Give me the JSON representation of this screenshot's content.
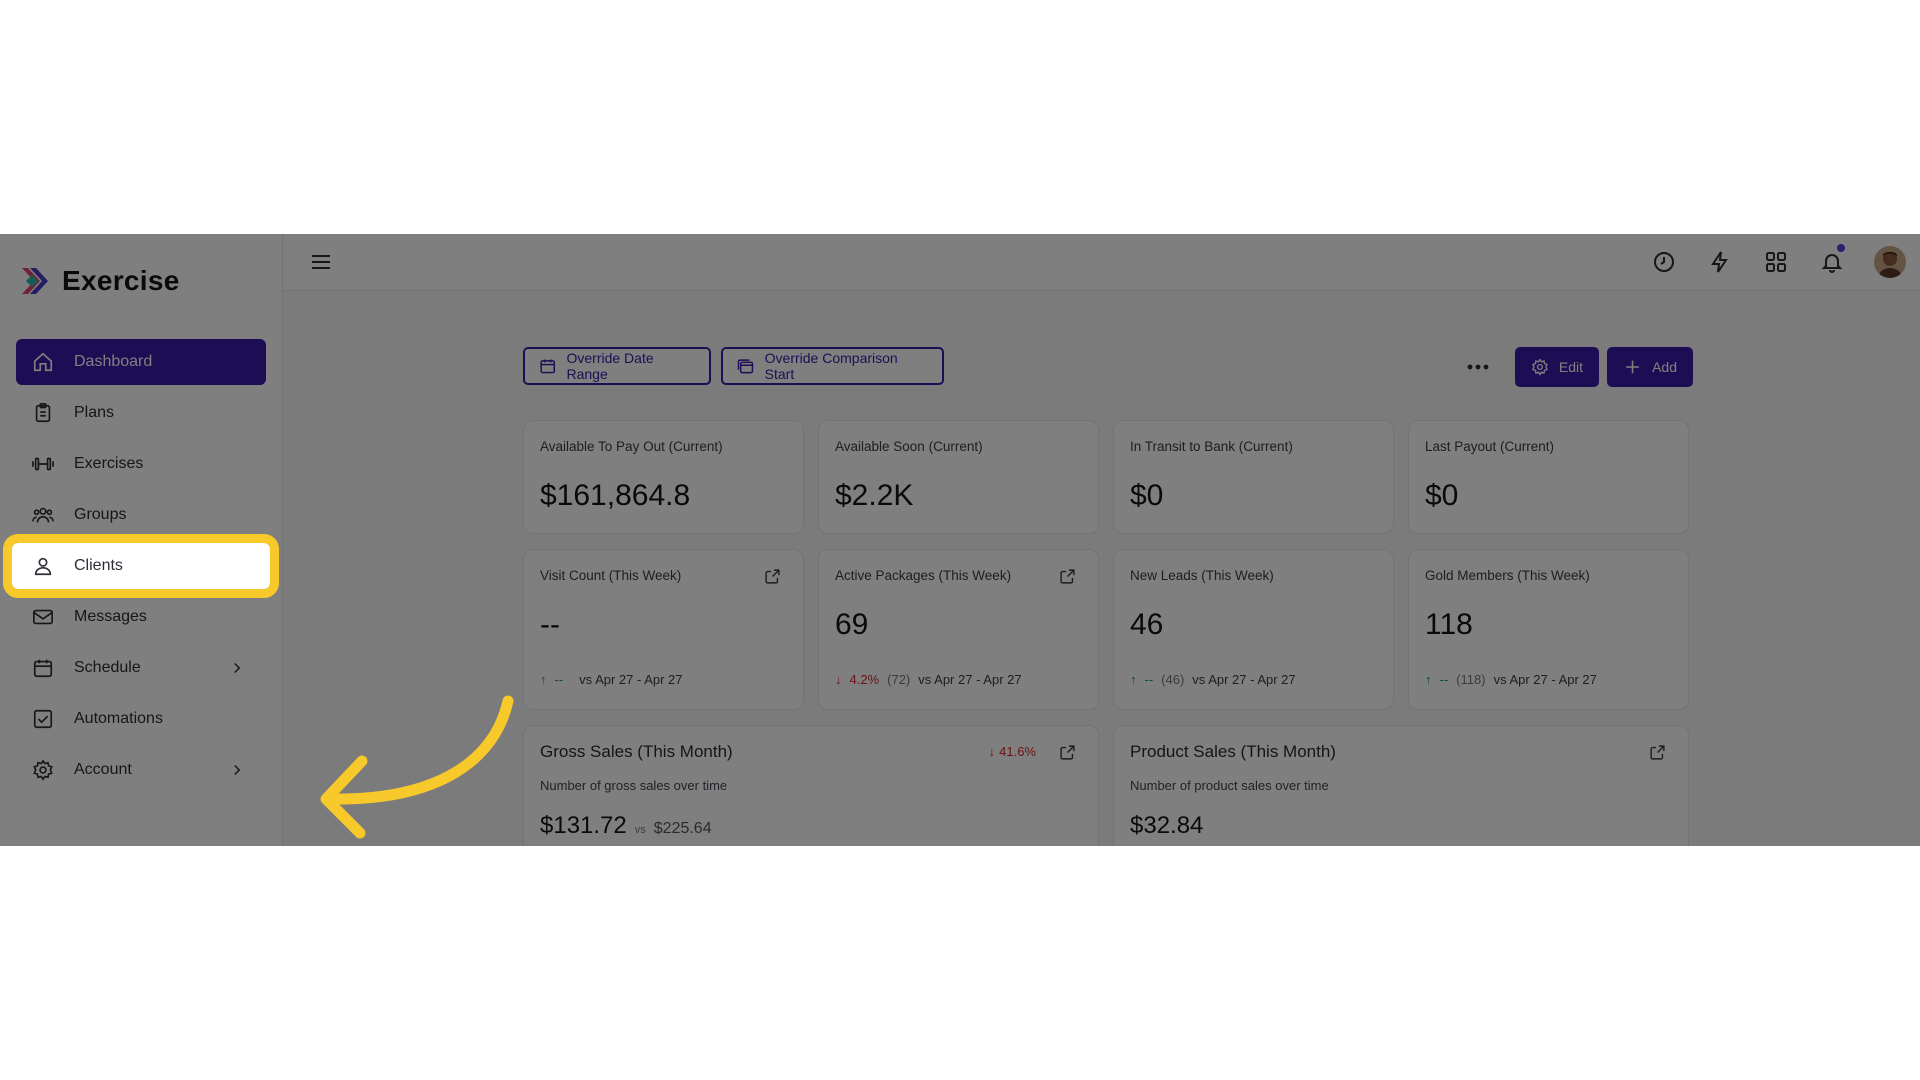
{
  "app": {
    "name": "Exercise"
  },
  "sidebar": {
    "items": [
      {
        "label": "Dashboard",
        "icon": "home-icon",
        "active": true
      },
      {
        "label": "Plans",
        "icon": "clipboard-icon"
      },
      {
        "label": "Exercises",
        "icon": "dumbbell-icon"
      },
      {
        "label": "Groups",
        "icon": "users-icon"
      },
      {
        "label": "Clients",
        "icon": "user-icon",
        "highlighted": true
      },
      {
        "label": "Messages",
        "icon": "envelope-icon"
      },
      {
        "label": "Schedule",
        "icon": "calendar-icon",
        "has_submenu": true
      },
      {
        "label": "Automations",
        "icon": "checkbox-icon"
      },
      {
        "label": "Account",
        "icon": "gear-icon",
        "has_submenu": true
      }
    ]
  },
  "topbar": {
    "icons": [
      "menu-icon",
      "clock-icon",
      "lightning-icon",
      "grid-icon",
      "bell-icon",
      "avatar"
    ]
  },
  "actions": {
    "override_date_range": "Override Date Range",
    "override_comparison_start": "Override Comparison Start",
    "edit": "Edit",
    "add": "Add"
  },
  "stats_row1": [
    {
      "title": "Available To Pay Out (Current)",
      "value": "$161,864.8"
    },
    {
      "title": "Available Soon (Current)",
      "value": "$2.2K"
    },
    {
      "title": "In Transit to Bank (Current)",
      "value": "$0"
    },
    {
      "title": "Last Payout (Current)",
      "value": "$0"
    }
  ],
  "stats_row2": [
    {
      "title": "Visit Count (This Week)",
      "value": "--",
      "trend": "up",
      "change": "--",
      "prev": "",
      "range": "vs Apr 27 - Apr 27"
    },
    {
      "title": "Active Packages (This Week)",
      "value": "69",
      "trend": "down",
      "change": "4.2%",
      "prev": "(72)",
      "range": "vs Apr 27 - Apr 27"
    },
    {
      "title": "New Leads (This Week)",
      "value": "46",
      "trend": "up",
      "change": "--",
      "prev": "(46)",
      "range": "vs Apr 27 - Apr 27"
    },
    {
      "title": "Gold Members (This Week)",
      "value": "118",
      "trend": "up",
      "change": "--",
      "prev": "(118)",
      "range": "vs Apr 27 - Apr 27"
    }
  ],
  "gross_sales": {
    "title": "Gross Sales (This Month)",
    "subtitle": "Number of gross sales over time",
    "value": "$131.72",
    "vs": "vs",
    "compare": "$225.64",
    "change": "41.6%"
  },
  "product_sales": {
    "title": "Product Sales (This Month)",
    "subtitle": "Number of product sales over time",
    "value": "$32.84"
  },
  "colors": {
    "accent": "#3b1aa8",
    "highlight": "#f7c92a",
    "up": "#16a34a",
    "down": "#dc2626"
  }
}
